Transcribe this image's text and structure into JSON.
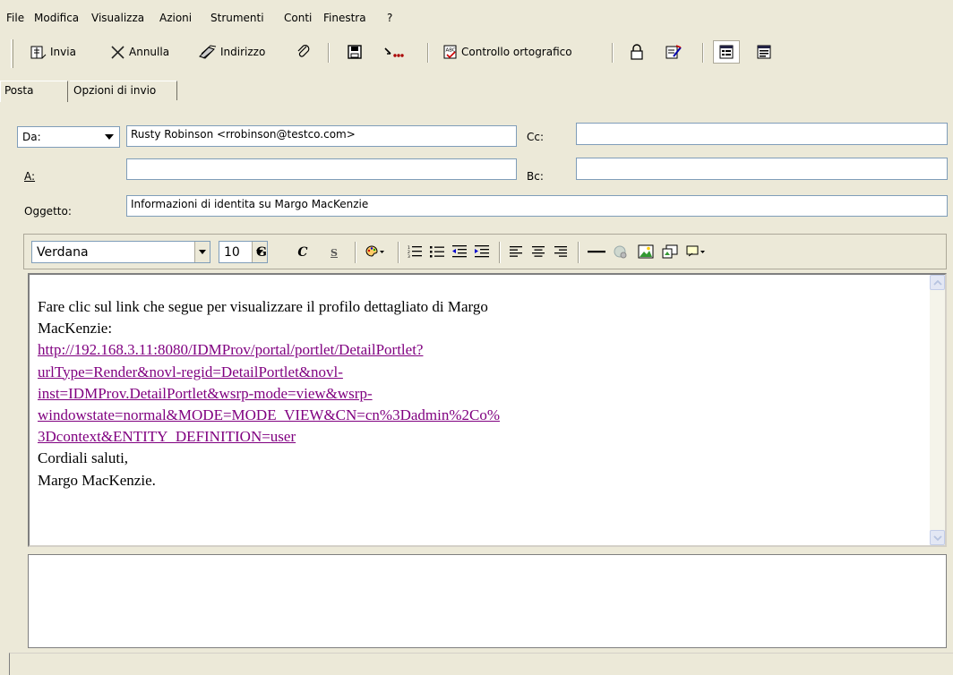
{
  "menu": {
    "items": [
      "File",
      "Modifica",
      "Visualizza",
      "Azioni",
      "Strumenti",
      "Conti",
      "Finestra",
      "?"
    ]
  },
  "toolbar": {
    "send_label": "Invia",
    "cancel_label": "Annulla",
    "address_label": "Indirizzo",
    "spellcheck_label": "Controllo ortografico"
  },
  "tabs": {
    "mail": "Posta",
    "send_options": "Opzioni di invio"
  },
  "header": {
    "from_label": "Da:",
    "from_value": "Rusty Robinson <rrobinson@testco.com>",
    "to_label": "A:",
    "to_value": "",
    "cc_label": "Cc:",
    "cc_value": "",
    "bc_label": "Bc:",
    "bc_value": "",
    "subject_label": "Oggetto:",
    "subject_value": "Informazioni di identita su Margo MacKenzie"
  },
  "format": {
    "font_value": "Verdana",
    "size_value": "10",
    "bold_label": "G",
    "italic_label": "C",
    "underline_label": "S"
  },
  "body": {
    "line1": "Fare clic sul link che segue per visualizzare il profilo dettagliato di Margo",
    "line2": "MacKenzie:",
    "link_lines": [
      "http://192.168.3.11:8080/IDMProv/portal/portlet/DetailPortlet?",
      "urlType=Render&novl-regid=DetailPortlet&novl-",
      "inst=IDMProv.DetailPortlet&wsrp-mode=view&wsrp-",
      "windowstate=normal&MODE=MODE_VIEW&CN=cn%3Dadmin%2Co%",
      "3Dcontext&ENTITY_DEFINITION=user"
    ],
    "closing": "Cordiali saluti,",
    "signature": "Margo MacKenzie."
  },
  "colors": {
    "window_bg": "#ece9d8",
    "link": "#800080",
    "input_border": "#7f9db9"
  }
}
